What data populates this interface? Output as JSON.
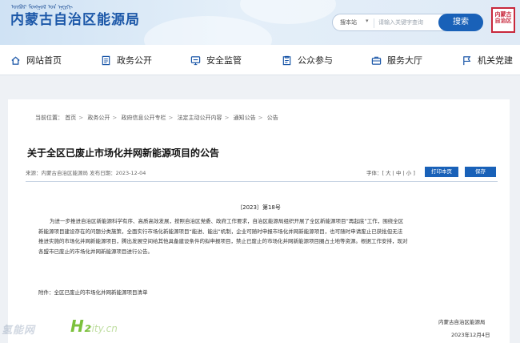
{
  "header": {
    "site_title": "内蒙古自治区能源局",
    "mongolian_line": "ᠥᠪᠥᠷ ᠮᠣᠩᠭᠣᠯ ᠤᠨ ᠡᠨᠧᠷᠭᠢ",
    "search": {
      "scope": "搜本站",
      "placeholder": "请输入关键字查询",
      "button": "搜索"
    },
    "seal_text": "内蒙古 自治区"
  },
  "nav": [
    {
      "label": "网站首页",
      "icon": "home-icon"
    },
    {
      "label": "政务公开",
      "icon": "document-icon"
    },
    {
      "label": "安全监管",
      "icon": "monitor-icon"
    },
    {
      "label": "公众参与",
      "icon": "clipboard-icon"
    },
    {
      "label": "服务大厅",
      "icon": "briefcase-icon"
    },
    {
      "label": "机关党建",
      "icon": "flag-icon"
    }
  ],
  "breadcrumb": {
    "prefix": "当前位置：",
    "items": [
      "首页",
      "政务公开",
      "政府信息公开专栏",
      "法定主动公开内容",
      "通知公告",
      "公告"
    ]
  },
  "article": {
    "title": "关于全区已废止市场化并网新能源项目的公告",
    "meta": "来源：内蒙古自治区能源局  发布日期：2023-12-04",
    "font_label": "字体：",
    "font_large": "大",
    "font_medium": "中",
    "font_small": "小",
    "print_button": "打印本页",
    "save_button": "保存",
    "doc_number": "〔2023〕第18号",
    "body_lines": [
      "为进一步推进自治区新能源科学有序、高质高效发展，按照自治区党委、政府工作要求，自治区能源局组织开展了全区新能源项目“再起底”工作，围绕全区",
      "新能源项目建设存在的问题分类施策，全面实行市场化新能源项目“能进、能出”机制，企业可随时申报市场化并网新能源项目，也可随时申请废止已获批但无法",
      "推进实施的市场化并网新能源项目，腾出发展空间给其他具备建设条件的拟申报项目，禁止已废止的市场化并网新能源项目圈占土地等资源。根据工作安排，现对",
      "各盟市已废止的市场化并网新能源项目进行公告。"
    ],
    "attachment": "附件：全区已废止的市场化并网新能源项目清单",
    "sign_org": "内蒙古自治区能源局",
    "sign_date": "2023年12月4日"
  },
  "watermark": {
    "text": "氢能网",
    "h2": "H₂",
    "url": "city.cn"
  }
}
